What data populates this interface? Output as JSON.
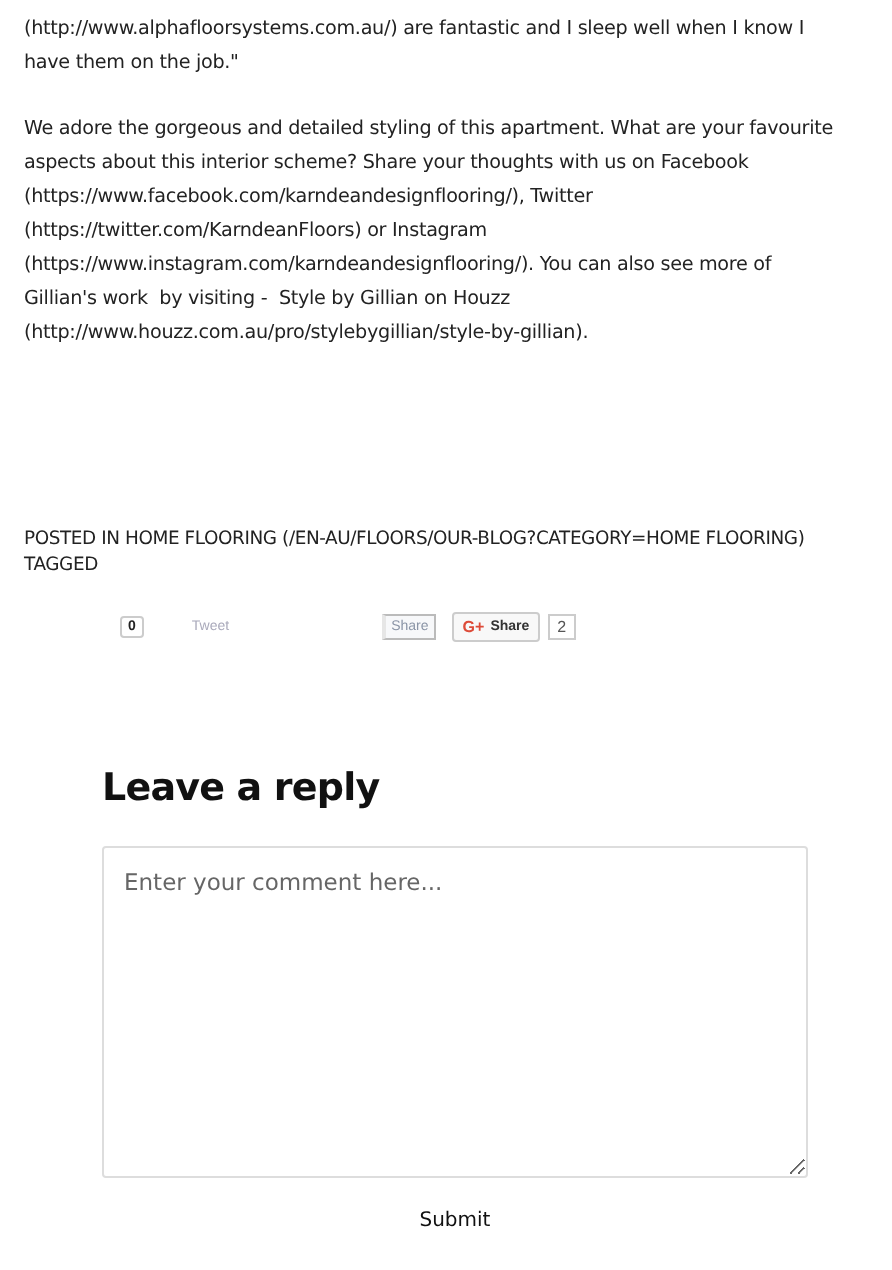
{
  "paragraphs": [
    [
      "(http://www.alphafloorsystems.com.au/) are fantastic and I sleep well when I know I",
      "have them on the job.\""
    ],
    [
      "We adore the gorgeous and detailed styling of this apartment. What are your favourite",
      "aspects about this interior scheme? Share your thoughts with us on Facebook",
      "(https://www.facebook.com/karndeandesignflooring/), Twitter",
      "(https://twitter.com/KarndeanFloors) or Instagram",
      "(https://www.instagram.com/karndeandesignflooring/). You can also see more of",
      "Gillian's work  by visiting -  Style by Gillian on Houzz",
      "(http://www.houzz.com.au/pro/stylebygillian/style-by-gillian)."
    ]
  ],
  "posted_in": "POSTED IN HOME FLOORING (/EN-AU/FLOORS/OUR-BLOG?CATEGORY=HOME FLOORING)",
  "tagged": "TAGGED",
  "share": {
    "count": "0",
    "tweet": "Tweet",
    "share": "Share",
    "gplus_logo": "G+",
    "gplus_share": "Share",
    "gplus_count": "2"
  },
  "reply": {
    "heading": "Leave a reply",
    "placeholder": "Enter your comment here...",
    "submit": "Submit"
  }
}
